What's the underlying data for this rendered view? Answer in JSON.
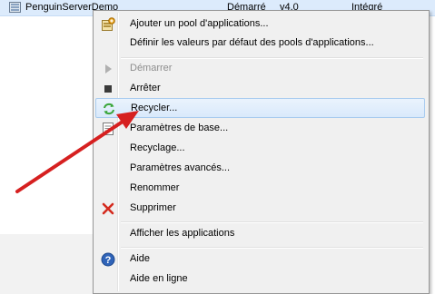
{
  "list_row": {
    "name": "PenguinServerDemo",
    "status": "Démarré",
    "version": "v4.0",
    "pipeline": "Intégré"
  },
  "menu": {
    "items": [
      {
        "label": "Ajouter un pool d'applications...",
        "icon": "add-pool-icon",
        "disabled": false
      },
      {
        "label": "Définir les valeurs par défaut des pools d'applications...",
        "icon": "",
        "disabled": false
      },
      {
        "label": "Démarrer",
        "icon": "play-icon",
        "disabled": true
      },
      {
        "label": "Arrêter",
        "icon": "stop-icon",
        "disabled": false
      },
      {
        "label": "Recycler...",
        "icon": "recycle-icon",
        "disabled": false,
        "highlighted": true
      },
      {
        "label": "Paramètres de base...",
        "icon": "settings-page-icon",
        "disabled": false
      },
      {
        "label": "Recyclage...",
        "icon": "",
        "disabled": false
      },
      {
        "label": "Paramètres avancés...",
        "icon": "",
        "disabled": false
      },
      {
        "label": "Renommer",
        "icon": "",
        "disabled": false
      },
      {
        "label": "Supprimer",
        "icon": "delete-icon",
        "disabled": false
      },
      {
        "label": "Afficher les applications",
        "icon": "",
        "disabled": false
      },
      {
        "label": "Aide",
        "icon": "help-icon",
        "disabled": false
      },
      {
        "label": "Aide en ligne",
        "icon": "",
        "disabled": false
      }
    ]
  },
  "colors": {
    "highlight_border": "#a8cbef",
    "arrow": "#d62020",
    "delete_red": "#d42a1e",
    "help_blue": "#2f63b8",
    "recycle_green": "#3aa63a"
  }
}
